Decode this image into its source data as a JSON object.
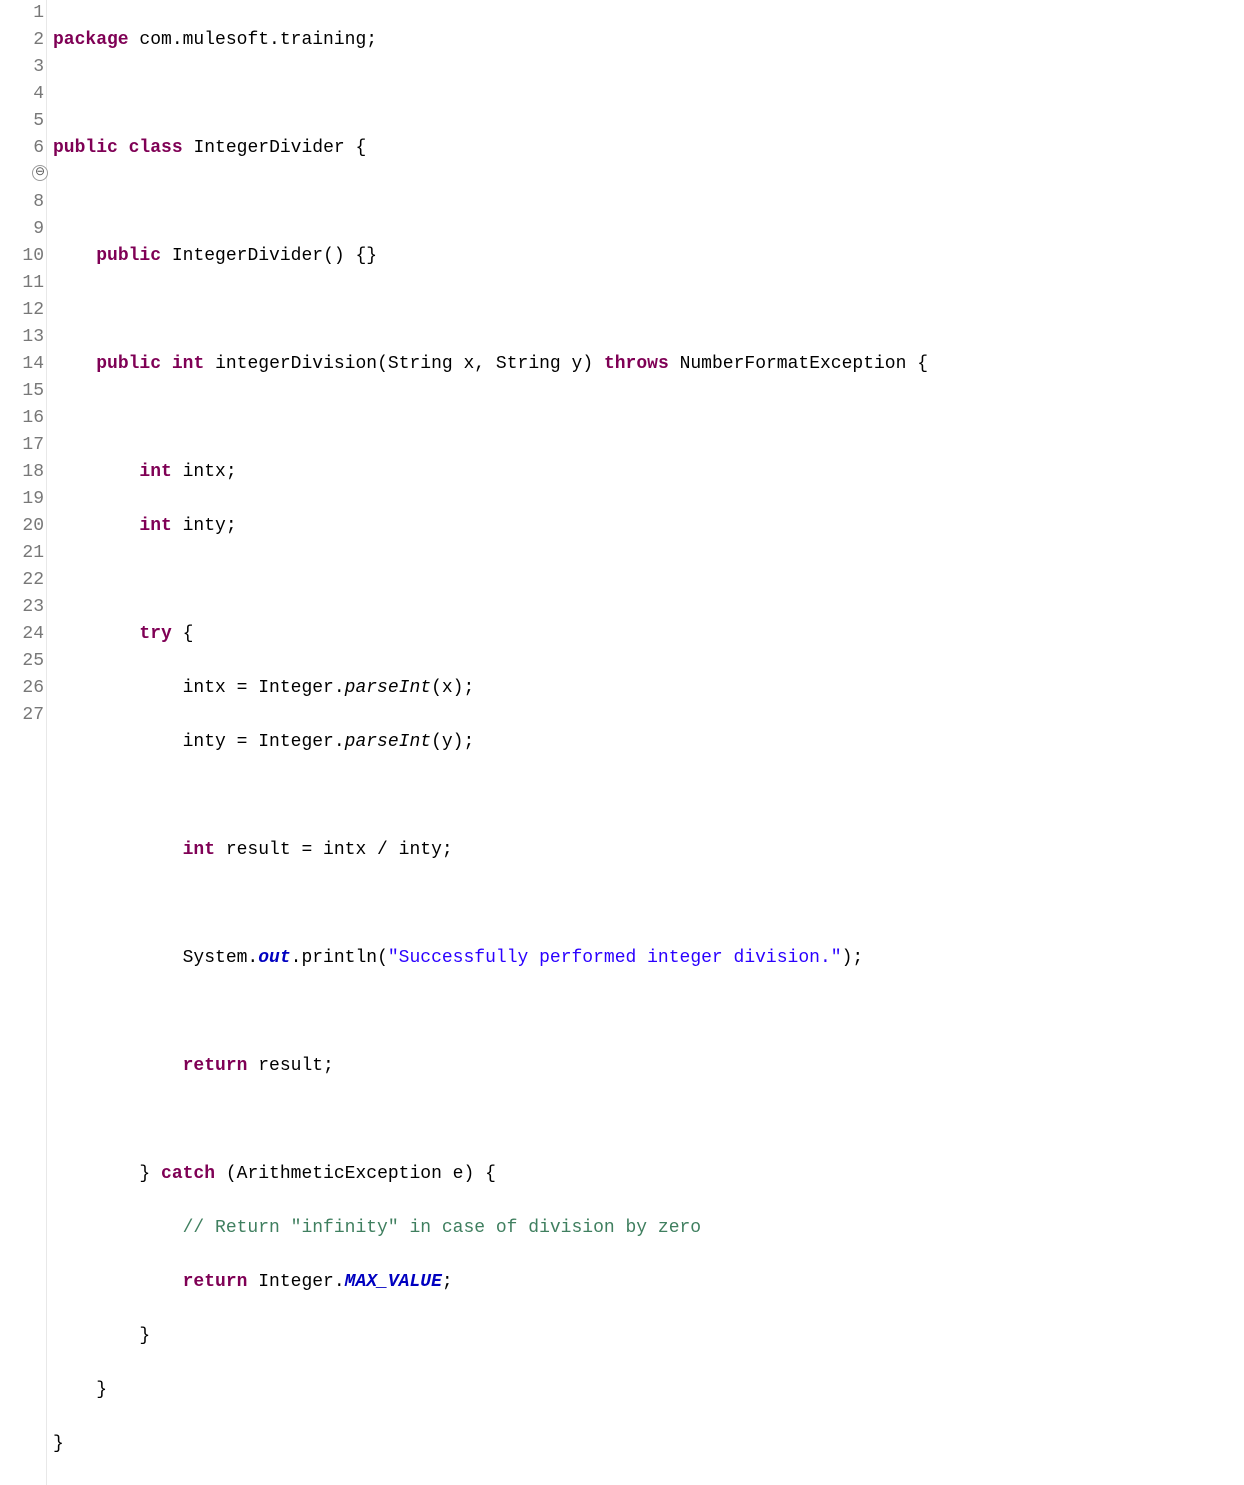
{
  "gutter": {
    "lines": [
      "1",
      "2",
      "3",
      "4",
      "5",
      "6",
      "7",
      "8",
      "9",
      "10",
      "11",
      "12",
      "13",
      "14",
      "15",
      "16",
      "17",
      "18",
      "19",
      "20",
      "21",
      "22",
      "23",
      "24",
      "25",
      "26",
      "27"
    ],
    "foldGlyph": "⊖"
  },
  "tokens": {
    "package": "package",
    "public": "public",
    "class": "class",
    "int_kw": "int",
    "throws": "throws",
    "try": "try",
    "catch": "catch",
    "return": "return",
    "pkgname": " com.mulesoft.training;",
    "ClassName": "IntegerDivider",
    "ctor_sig": "IntegerDivider() {}",
    "method_name": "integerDivision",
    "params": "(String x, String y)",
    "exception": "NumberFormatException",
    "intx_decl": " intx;",
    "inty_decl": " inty;",
    "open_brace": " {",
    "close_brace": "}",
    "assign_intx_pre": "intx = Integer.",
    "assign_inty_pre": "inty = Integer.",
    "parseInt": "parseInt",
    "call_x": "(x);",
    "call_y": "(y);",
    "result_decl": " result = intx / inty;",
    "sysout_pre": "System.",
    "out": "out",
    "println_pre": ".println(",
    "success_str": "\"Successfully performed integer division.\"",
    "println_post": ");",
    "return_result": " result;",
    "catch_cb_sp": "} ",
    "catch_sig": " (ArithmeticException e) {",
    "comment": "// Return \"infinity\" in case of division by zero",
    "ret_int_pre": " Integer.",
    "MAX_VALUE": "MAX_VALUE",
    "semicolon": ";",
    "space": " ",
    "ind1": "    ",
    "ind2": "        ",
    "ind3": "            ",
    "ind4": "                "
  }
}
